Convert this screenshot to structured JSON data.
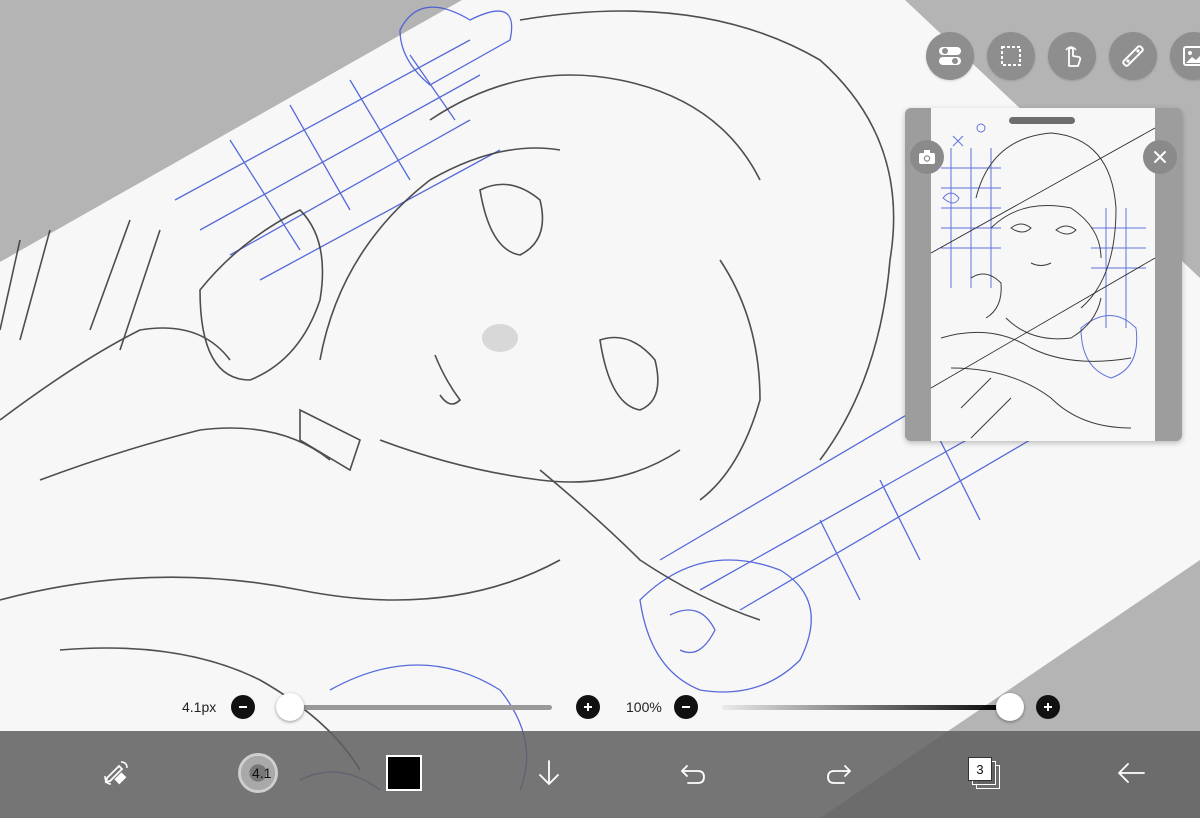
{
  "top_tools": [
    {
      "name": "toggle-icon"
    },
    {
      "name": "selection-icon"
    },
    {
      "name": "hand-icon"
    },
    {
      "name": "ruler-icon"
    },
    {
      "name": "image-icon"
    }
  ],
  "brush_slider": {
    "value_label": "4.1px",
    "value_fraction": 0.03
  },
  "opacity_slider": {
    "value_label": "100%",
    "value_fraction": 1.0
  },
  "toolbar": {
    "brush_size_text": "4.1",
    "color": "#000000",
    "layer_count": "3"
  },
  "colors": {
    "sketch_blue": "#3a52d6",
    "sketch_gray": "#3c3c3c",
    "toolbar_bg": "#606060"
  }
}
